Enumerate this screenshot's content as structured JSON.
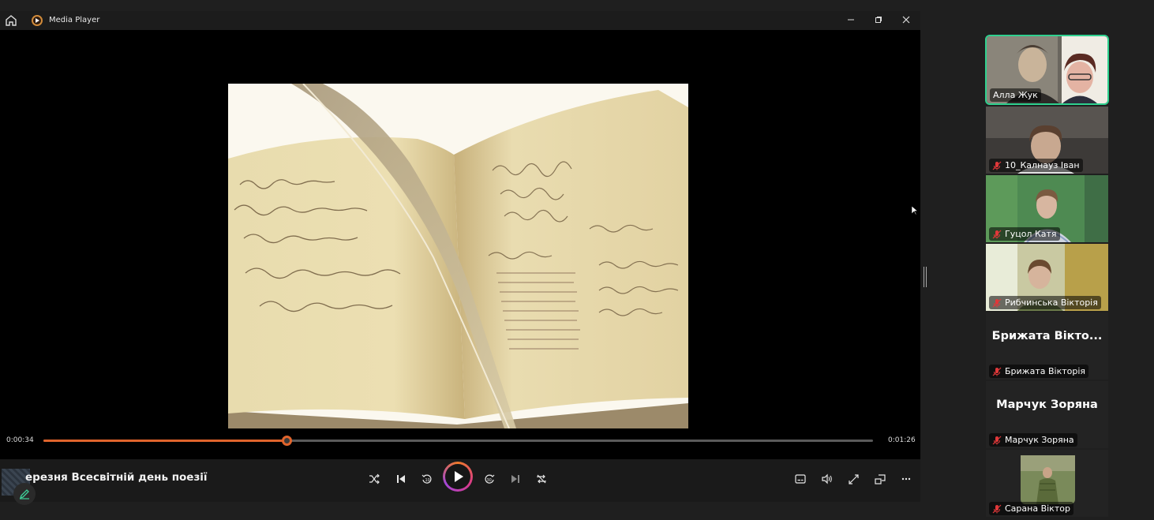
{
  "player": {
    "title": "Media Player",
    "current_time": "0:00:34",
    "total_time": "0:01:26",
    "progress": 0.293,
    "media_title": "ерезня Всесвітній день поезії"
  },
  "participants": [
    {
      "name": "Алла Жук",
      "active": true,
      "muted": false
    },
    {
      "name": "10_Калнауз Іван",
      "muted": true
    },
    {
      "name": "Гуцол Катя",
      "muted": true
    },
    {
      "name": "Рибчинська Вікторія",
      "muted": true
    },
    {
      "name": "Брижата Вікторія",
      "display": "Брижата  Вікто...",
      "muted": true
    },
    {
      "name": "Марчук Зоряна",
      "display": "Марчук Зоряна",
      "muted": true
    },
    {
      "name": "Сарана Віктор",
      "muted": true
    }
  ],
  "colors": {
    "accent": "#e0642c",
    "active_border": "#2fd18f",
    "mic_off": "#e0383a"
  }
}
